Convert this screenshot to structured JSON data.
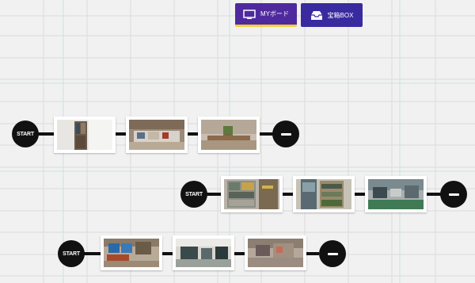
{
  "header": {
    "mypage_label": "MYボード",
    "box_label": "宝箱BOX",
    "mypage_icon": "monitor-icon",
    "box_icon": "inbox-icon",
    "mypage_color": "#4f2a9e",
    "box_color": "#3a2aa0",
    "active_underline_color": "#f2d13d"
  },
  "rows": [
    {
      "start_label": "START",
      "photos": [
        "photo-storage-room",
        "photo-workbench-tools",
        "photo-desk-plant"
      ]
    },
    {
      "start_label": "START",
      "photos": [
        "photo-shelf-cabinet",
        "photo-doorway-shelf",
        "photo-garage-equipment"
      ]
    },
    {
      "start_label": "START",
      "photos": [
        "photo-blue-bins",
        "photo-machines",
        "photo-workshop-floor"
      ]
    }
  ]
}
